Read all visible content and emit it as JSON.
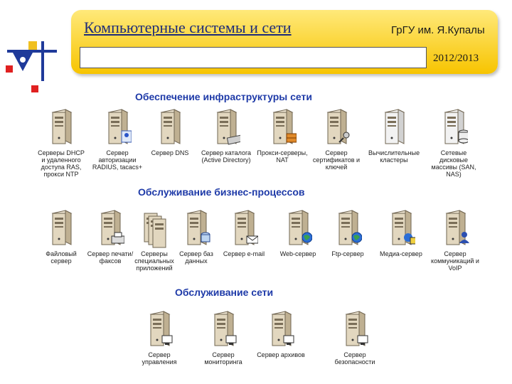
{
  "header": {
    "title": "Компьютерные системы и сети",
    "university": "ГрГУ им. Я.Купалы",
    "year": "2012/2013"
  },
  "sections": [
    {
      "title": "Обеспечение инфраструктуры сети",
      "items": [
        {
          "label": "Серверы DHCP и удаленного доступа RAS, прокси NTP",
          "badge": "none",
          "style": "plain"
        },
        {
          "label": "Сервер авторизации RADIUS, tacacs+",
          "badge": "card",
          "style": "plain"
        },
        {
          "label": "Сервер DNS",
          "badge": "none",
          "style": "plain"
        },
        {
          "label": "Сервер каталога (Active Directory)",
          "badge": "keyboard",
          "style": "plain"
        },
        {
          "label": "Прокси-серверы, NAT",
          "badge": "firewall",
          "style": "plain"
        },
        {
          "label": "Сервер сертификатов и ключей",
          "badge": "key",
          "style": "plain"
        },
        {
          "label": "Вычислительные кластеры",
          "badge": "none",
          "style": "white"
        },
        {
          "label": "Сетевые дисковые массивы (SAN, NAS)",
          "badge": "disk",
          "style": "white"
        }
      ]
    },
    {
      "title": "Обслуживание бизнес-процессов",
      "items": [
        {
          "label": "Файловый сервер",
          "badge": "none",
          "style": "plain"
        },
        {
          "label": "Сервер печати/факсов",
          "badge": "printer",
          "style": "plain"
        },
        {
          "label": "Серверы специальных приложений",
          "badge": "none",
          "style": "rack"
        },
        {
          "label": "Сервер баз данных",
          "badge": "database",
          "style": "plain"
        },
        {
          "label": "Сервер e-mail",
          "badge": "mail",
          "style": "plain"
        },
        {
          "label": "Web-сервер",
          "badge": "globe",
          "style": "plain"
        },
        {
          "label": "Ftp-сервер",
          "badge": "globe",
          "style": "plain"
        },
        {
          "label": "Медиа-сервер",
          "badge": "media",
          "style": "plain"
        },
        {
          "label": "Сервер коммуникаций и VoIP",
          "badge": "person",
          "style": "plain"
        }
      ]
    },
    {
      "title": "Обслуживание сети",
      "items": [
        {
          "label": "Сервер управления",
          "badge": "monitor",
          "style": "plain"
        },
        {
          "label": "Сервер мониторинга",
          "badge": "monitor",
          "style": "plain"
        },
        {
          "label": "Сервер архивов",
          "badge": "monitor",
          "style": "plain"
        },
        {
          "label": "Сервер безопасности",
          "badge": "monitor",
          "style": "plain"
        }
      ]
    }
  ]
}
